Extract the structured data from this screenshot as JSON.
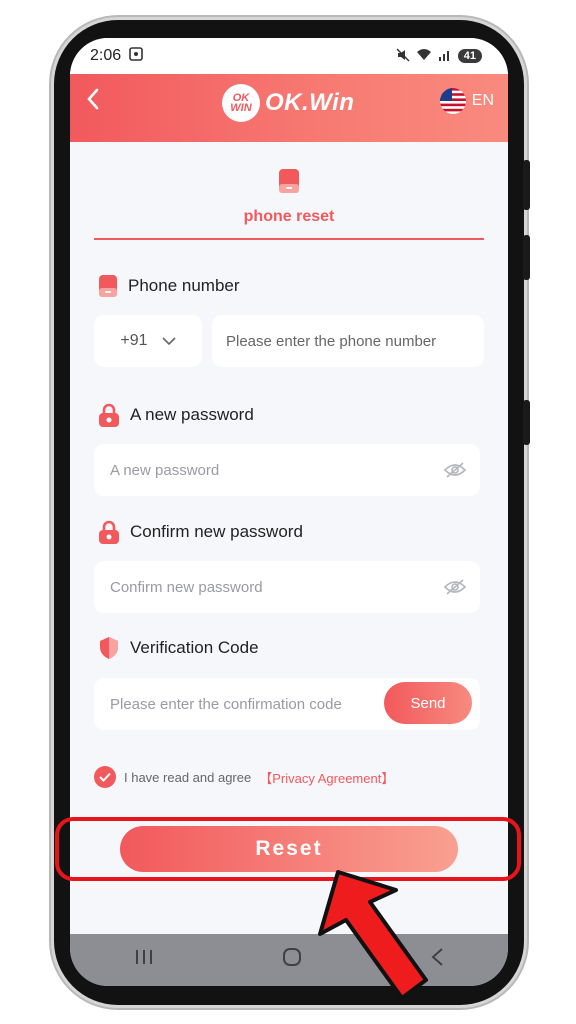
{
  "status": {
    "time": "2:06",
    "battery": "41"
  },
  "header": {
    "logo_badge": "OK WIN",
    "logo_text": "OK.Win",
    "lang": "EN",
    "back_icon": "chevron-left-icon"
  },
  "tab": {
    "label": "phone reset"
  },
  "phone": {
    "label": "Phone number",
    "country_code": "+91",
    "placeholder": "Please enter the phone number"
  },
  "new_password": {
    "label": "A new password",
    "placeholder": "A new password"
  },
  "confirm_password": {
    "label": "Confirm new password",
    "placeholder": "Confirm new password"
  },
  "verification": {
    "label": "Verification Code",
    "placeholder": "Please enter the confirmation code",
    "send": "Send"
  },
  "agreement": {
    "text": "I have read and agree",
    "link": "【Privacy Agreement】",
    "checked": true
  },
  "reset_button": "Reset",
  "colors": {
    "accent": "#f2595d",
    "highlight": "#e8141b"
  }
}
